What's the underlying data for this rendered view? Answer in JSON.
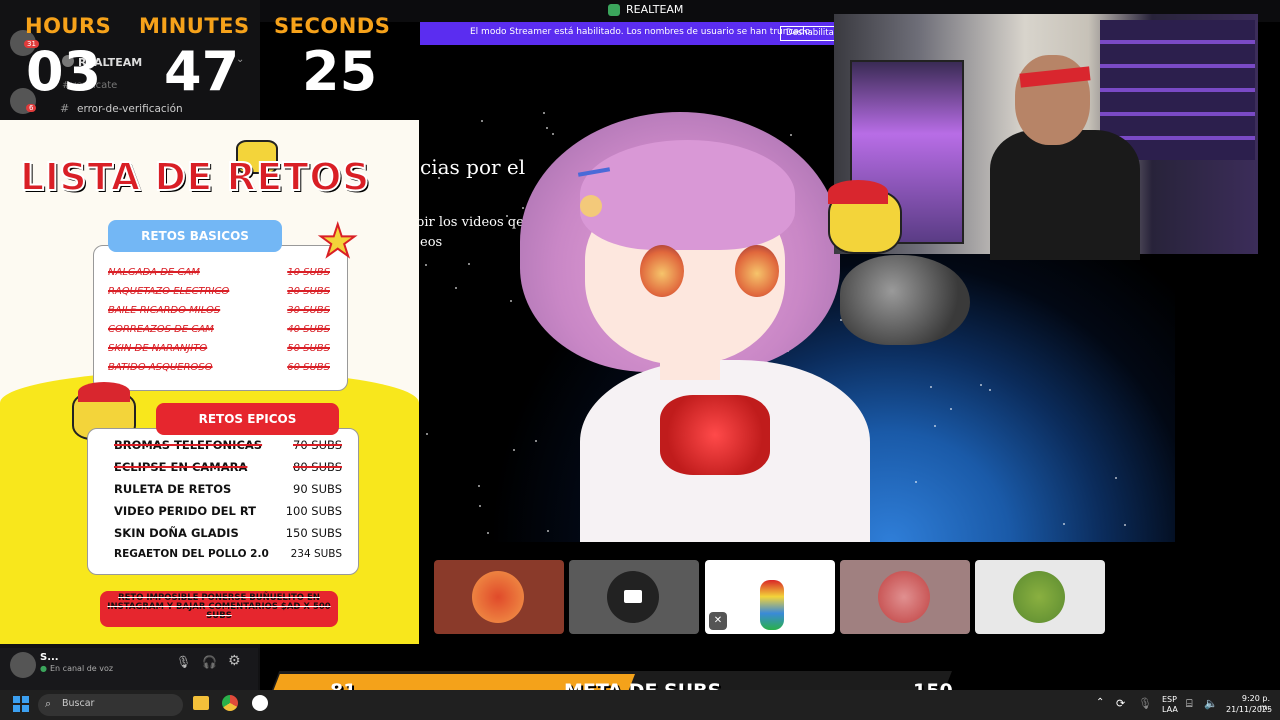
{
  "window": {
    "title": "REALTEAM",
    "streamer_banner": "El modo Streamer está habilitado. Los nombres de usuario se han truncado.",
    "streamer_button": "Deshabilitar"
  },
  "sidebar": {
    "server_name": "REALTEAM",
    "channel_faint": "#verificate",
    "channel": "error-de-verificación",
    "badge_top": "31",
    "badge_bottom": "6"
  },
  "timer": {
    "hours_label": "HOURS",
    "minutes_label": "MINUTES",
    "seconds_label": "SECONDS",
    "hours": "03",
    "minutes": "47",
    "seconds": "25"
  },
  "retos": {
    "title": "LISTA DE RETOS",
    "basic_label": "RETOS BASICOS",
    "basic": [
      {
        "name": "NALGADA DE CAM",
        "subs": "10 SUBS"
      },
      {
        "name": "RAQUETAZO ELECTRICO",
        "subs": "20 SUBS"
      },
      {
        "name": "BAILE RICARDO MILOS",
        "subs": "30 SUBS"
      },
      {
        "name": "CORREAZOS DE CAM",
        "subs": "40 SUBS"
      },
      {
        "name": "SKIN DE NARANJITO",
        "subs": "50 SUBS"
      },
      {
        "name": "BATIDO ASQUEROSO",
        "subs": "60 SUBS"
      }
    ],
    "epic_label": "RETOS EPICOS",
    "epic": [
      {
        "name": "BROMAS TELEFONICAS",
        "subs": "70 SUBS",
        "done": true
      },
      {
        "name": "ECLIPSE EN CAMARA",
        "subs": "80 SUBS",
        "done": true
      },
      {
        "name": "RULETA DE RETOS",
        "subs": "90 SUBS",
        "done": false
      },
      {
        "name": "VIDEO PERIDO DEL RT",
        "subs": "100 SUBS",
        "done": false
      },
      {
        "name": "SKIN DOÑA GLADIS",
        "subs": "150 SUBS",
        "done": false
      },
      {
        "name": "REGAETON DEL POLLO 2.0",
        "subs": "234 SUBS",
        "done": false
      }
    ],
    "imposible": "RETO IMPOSIBLE PONERSE BUÑUELITO EN INSTAGRAM Y BAJAR COMENTARIOS $AD X 500 SUBS"
  },
  "document": {
    "line1": "cias por el",
    "line2": "bir los videos qe",
    "line3": "eos"
  },
  "voice": {
    "user": "S...",
    "status": "En canal de voz"
  },
  "meta": {
    "current": "81",
    "label": "META DE SUBS",
    "goal": "150",
    "progress_fraction": 0.54
  },
  "taskbar": {
    "search_placeholder": "Buscar",
    "lang": "ESP",
    "lang2": "LAA",
    "time": "9:20 p. m.",
    "date": "21/11/2025"
  }
}
